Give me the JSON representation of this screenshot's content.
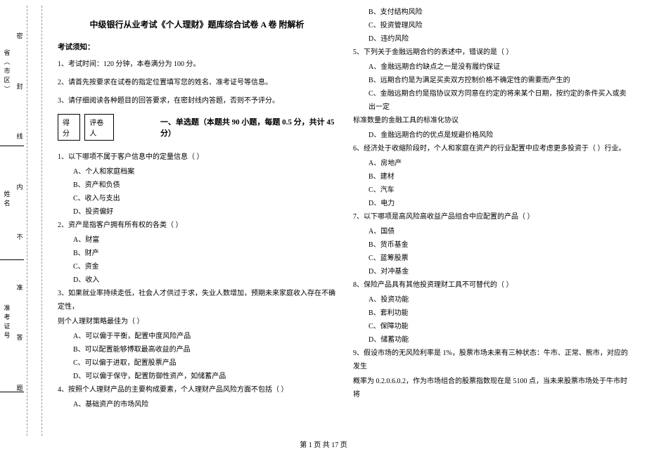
{
  "binding": {
    "fields": [
      "省（市区）",
      "姓名",
      "准考证号"
    ],
    "markers": [
      "密",
      "封",
      "线",
      "内",
      "不",
      "准",
      "答",
      "题"
    ],
    "sections": []
  },
  "title": "中级银行从业考试《个人理财》题库综合试卷 A 卷 附解析",
  "notice": {
    "header": "考试须知：",
    "items": [
      "1、考试时间：120 分钟，本卷满分为 100 分。",
      "2、请首先按要求在试卷的指定位置填写您的姓名、准考证号等信息。",
      "3、请仔细阅读各种题目的回答要求，在密封线内答题，否则不予评分。"
    ]
  },
  "score": {
    "label1": "得分",
    "label2": "评卷人"
  },
  "section1": {
    "title": "一、单选题（本题共 90 小题，每题 0.5 分，共计 45 分）"
  },
  "q1": {
    "text": "1、以下哪项不属于客户信息中的定量信息（    ）",
    "a": "A、个人和家庭档案",
    "b": "B、资产和负债",
    "c": "C、收入与支出",
    "d": "D、投资偏好"
  },
  "q2": {
    "text": "2、资产是指客户拥有所有权的各类（    ）",
    "a": "A、财富",
    "b": "B、财产",
    "c": "C、资金",
    "d": "D、收入"
  },
  "q3": {
    "text": "3、如果就业率持续走低，社会人才供过于求，失业人数增加，预期未来家庭收入存在不确定性，",
    "text2": "则个人理财策略最佳为（    ）",
    "a": "A、可以偏于平衡，配置中度风险产品",
    "b": "B、可以配置能够博取最高收益的产品",
    "c": "C、可以偏于进取，配置股票产品",
    "d": "D、可以偏于保守，配置防御性资产，如储蓄产品"
  },
  "q4": {
    "text": "4、按照个人理财产品的主要构成要素，个人理财产品风险方面不包括（    ）",
    "a": "A、基础资产的市场风险"
  },
  "q4r": {
    "b": "B、支付结构风险",
    "c": "C、投资管理风险",
    "d": "D、违约风险"
  },
  "q5": {
    "text": "5、下列关于金融远期合约的表述中，错误的是（    ）",
    "a": "A、金融远期合约缺点之一是没有履约保证",
    "b": "B、远期合约是为满足买卖双方控制价格不确定性的需要而产生的",
    "c": "C、金融远期合约是指协议双方同意在约定的将来某个日期，按约定的条件买入或卖出一定",
    "c2": "标准数量的金融工具的标准化协议",
    "d": "D、金融远期合约的优点是规避价格风险"
  },
  "q6": {
    "text": "6、经济处于收缩阶段时，个人和家庭在资产的行业配置中应考虑更多投资于（    ）行业。",
    "a": "A、房地产",
    "b": "B、建材",
    "c": "C、汽车",
    "d": "D、电力"
  },
  "q7": {
    "text": "7、以下哪项是高风险高收益产品组合中应配置的产品（    ）",
    "a": "A、国债",
    "b": "B、货币基金",
    "c": "C、蓝筹股票",
    "d": "D、对冲基金"
  },
  "q8": {
    "text": "8、保险产品具有其他投资理财工具不可替代的（    ）",
    "a": "A、投资功能",
    "b": "B、套利功能",
    "c": "C、保障功能",
    "d": "D、储蓄功能"
  },
  "q9": {
    "text": "9、假设市场的无风险利率是 1%，股票市场未来有三种状态：牛市、正常、熊市，对应的发生",
    "text2": "概率为 0.2.0.6.0.2，作为市场组合的股票指数现在是 5100 点，当未来股票市场处于牛市时将"
  },
  "footer": "第 1 页 共 17 页"
}
